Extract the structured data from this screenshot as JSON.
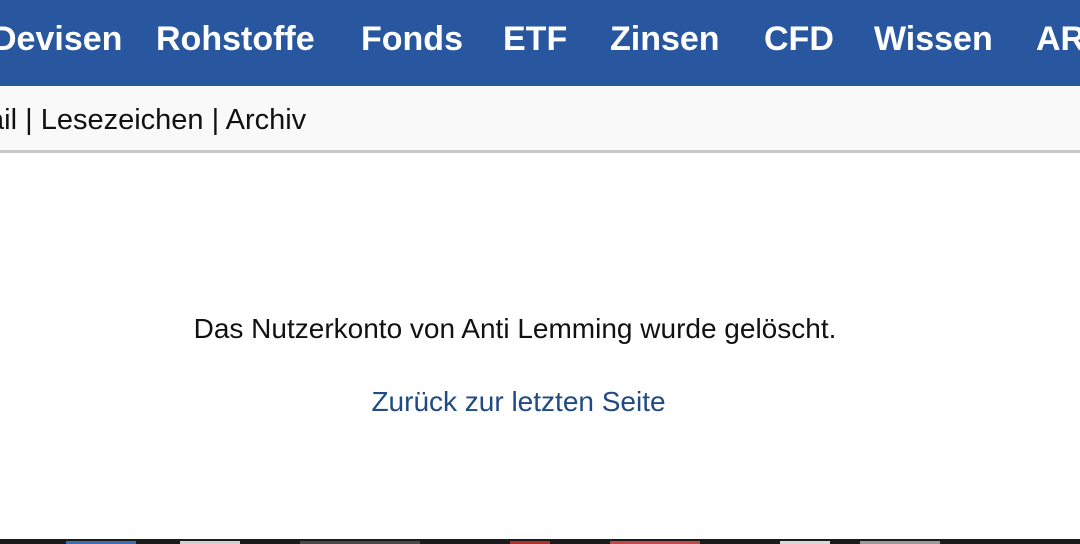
{
  "top_nav": {
    "items": [
      {
        "label": "Devisen"
      },
      {
        "label": "Rohstoffe"
      },
      {
        "label": "Fonds"
      },
      {
        "label": "ETF"
      },
      {
        "label": "Zinsen"
      },
      {
        "label": "CFD"
      },
      {
        "label": "Wissen"
      },
      {
        "label": "AR"
      }
    ],
    "background_color": "#2857a0"
  },
  "sub_nav": {
    "items": [
      {
        "label": "ail"
      },
      {
        "label": "Lesezeichen"
      },
      {
        "label": "Archiv"
      }
    ],
    "separator": "|"
  },
  "main": {
    "message": "Das Nutzerkonto von Anti Lemming wurde gelöscht.",
    "back_link": "Zurück zur letzten Seite",
    "link_color": "#1f4a82"
  }
}
